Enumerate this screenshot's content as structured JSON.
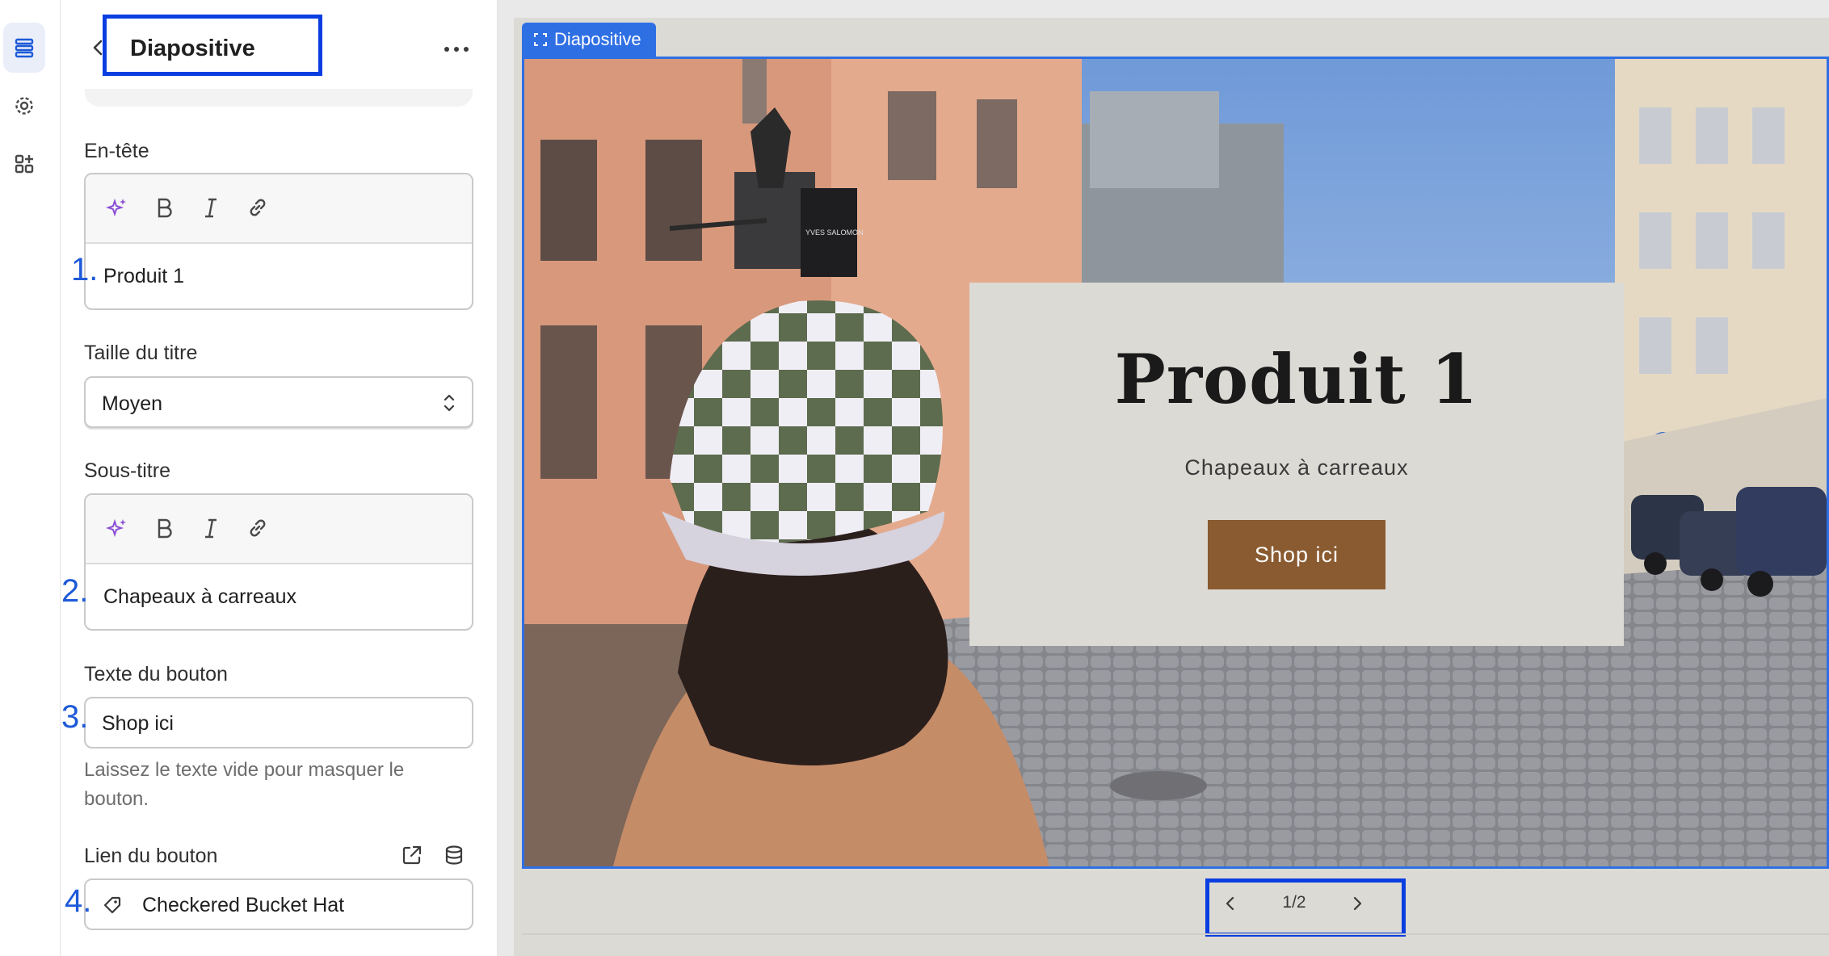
{
  "panel": {
    "title": "Diapositive",
    "heading_label": "En-tête",
    "heading_value": "Produit 1",
    "title_size_label": "Taille du titre",
    "title_size_value": "Moyen",
    "subtitle_label": "Sous-titre",
    "subtitle_value": "Chapeaux à carreaux",
    "button_text_label": "Texte du bouton",
    "button_text_value": "Shop ici",
    "button_text_help": "Laissez le texte vide pour masquer le bouton.",
    "button_link_label": "Lien du bouton",
    "button_link_value": "Checkered Bucket Hat"
  },
  "annotations": [
    "1.",
    "2.",
    "3.",
    "4."
  ],
  "preview": {
    "tag_label": "Diapositive",
    "hero_title": "Produit 1",
    "hero_subtitle": "Chapeaux à carreaux",
    "hero_button": "Shop ici",
    "pager": "1/2",
    "sign_text": "YVES SALOMON"
  },
  "colors": {
    "highlight": "#0a3ee0",
    "selection": "#2f6fe4",
    "hero_button": "#8a5a30"
  }
}
